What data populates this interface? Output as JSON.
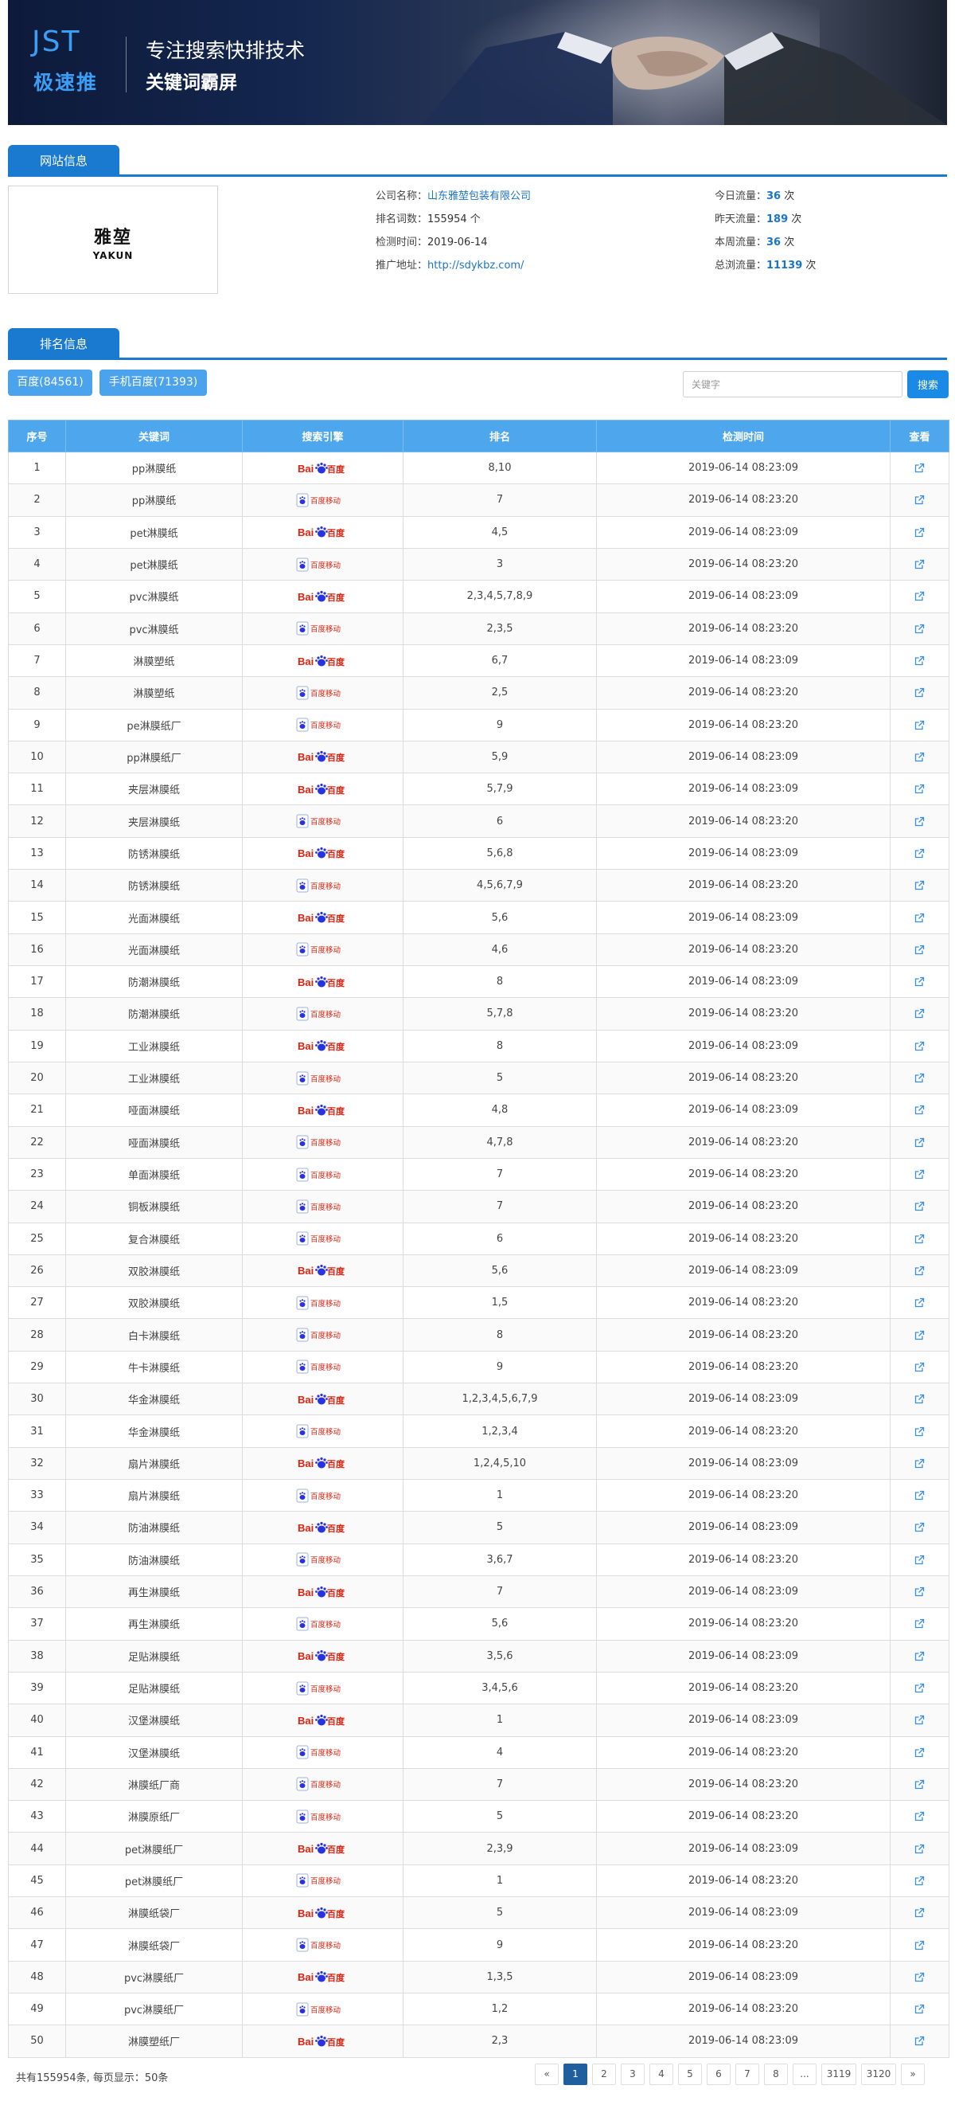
{
  "banner": {
    "logo_text": "JST",
    "logo_cn": "极速推",
    "slogan_line1": "专注搜索快排技术",
    "slogan_line2": "关键词霸屏"
  },
  "site_section": {
    "tab_label": "网站信息"
  },
  "site_logo": {
    "cn": "雅堃",
    "en": "YAKUN"
  },
  "site_info": {
    "company_label": "公司名称：",
    "company_value": "山东雅堃包装有限公司",
    "keywords_label": "排名词数：",
    "keywords_value": "155954 个",
    "check_label": "检测时间：",
    "check_value": "2019-06-14",
    "url_label": "推广地址：",
    "url_value": "http://sdykbz.com/"
  },
  "traffic": {
    "today_label": "今日流量：",
    "today_value": "36",
    "today_unit": "次",
    "yesterday_label": "昨天流量：",
    "yesterday_value": "189",
    "yesterday_unit": "次",
    "week_label": "本周流量：",
    "week_value": "36",
    "week_unit": "次",
    "total_label": "总浏流量：",
    "total_value": "11139",
    "total_unit": "次"
  },
  "rank_section": {
    "tab_label": "排名信息"
  },
  "engine_buttons": {
    "baidu": "百度(84561)",
    "mobile": "手机百度(71393)"
  },
  "search": {
    "placeholder": "关键字",
    "button_label": "搜索"
  },
  "table": {
    "headers": [
      "序号",
      "关键词",
      "搜索引擎",
      "排名",
      "检测时间",
      "查看"
    ],
    "rows": [
      {
        "no": "1",
        "kw": "pp淋膜纸",
        "engine": "baidu",
        "rank": "8,10",
        "time": "2019-06-14 08:23:09"
      },
      {
        "no": "2",
        "kw": "pp淋膜纸",
        "engine": "mobile",
        "rank": "7",
        "time": "2019-06-14 08:23:20"
      },
      {
        "no": "3",
        "kw": "pet淋膜纸",
        "engine": "baidu",
        "rank": "4,5",
        "time": "2019-06-14 08:23:09"
      },
      {
        "no": "4",
        "kw": "pet淋膜纸",
        "engine": "mobile",
        "rank": "3",
        "time": "2019-06-14 08:23:20"
      },
      {
        "no": "5",
        "kw": "pvc淋膜纸",
        "engine": "baidu",
        "rank": "2,3,4,5,7,8,9",
        "time": "2019-06-14 08:23:09"
      },
      {
        "no": "6",
        "kw": "pvc淋膜纸",
        "engine": "mobile",
        "rank": "2,3,5",
        "time": "2019-06-14 08:23:20"
      },
      {
        "no": "7",
        "kw": "淋膜塑纸",
        "engine": "baidu",
        "rank": "6,7",
        "time": "2019-06-14 08:23:09"
      },
      {
        "no": "8",
        "kw": "淋膜塑纸",
        "engine": "mobile",
        "rank": "2,5",
        "time": "2019-06-14 08:23:20"
      },
      {
        "no": "9",
        "kw": "pe淋膜纸厂",
        "engine": "mobile",
        "rank": "9",
        "time": "2019-06-14 08:23:20"
      },
      {
        "no": "10",
        "kw": "pp淋膜纸厂",
        "engine": "baidu",
        "rank": "5,9",
        "time": "2019-06-14 08:23:09"
      },
      {
        "no": "11",
        "kw": "夹层淋膜纸",
        "engine": "baidu",
        "rank": "5,7,9",
        "time": "2019-06-14 08:23:09"
      },
      {
        "no": "12",
        "kw": "夹层淋膜纸",
        "engine": "mobile",
        "rank": "6",
        "time": "2019-06-14 08:23:20"
      },
      {
        "no": "13",
        "kw": "防锈淋膜纸",
        "engine": "baidu",
        "rank": "5,6,8",
        "time": "2019-06-14 08:23:09"
      },
      {
        "no": "14",
        "kw": "防锈淋膜纸",
        "engine": "mobile",
        "rank": "4,5,6,7,9",
        "time": "2019-06-14 08:23:20"
      },
      {
        "no": "15",
        "kw": "光面淋膜纸",
        "engine": "baidu",
        "rank": "5,6",
        "time": "2019-06-14 08:23:09"
      },
      {
        "no": "16",
        "kw": "光面淋膜纸",
        "engine": "mobile",
        "rank": "4,6",
        "time": "2019-06-14 08:23:20"
      },
      {
        "no": "17",
        "kw": "防潮淋膜纸",
        "engine": "baidu",
        "rank": "8",
        "time": "2019-06-14 08:23:09"
      },
      {
        "no": "18",
        "kw": "防潮淋膜纸",
        "engine": "mobile",
        "rank": "5,7,8",
        "time": "2019-06-14 08:23:20"
      },
      {
        "no": "19",
        "kw": "工业淋膜纸",
        "engine": "baidu",
        "rank": "8",
        "time": "2019-06-14 08:23:09"
      },
      {
        "no": "20",
        "kw": "工业淋膜纸",
        "engine": "mobile",
        "rank": "5",
        "time": "2019-06-14 08:23:20"
      },
      {
        "no": "21",
        "kw": "哑面淋膜纸",
        "engine": "baidu",
        "rank": "4,8",
        "time": "2019-06-14 08:23:09"
      },
      {
        "no": "22",
        "kw": "哑面淋膜纸",
        "engine": "mobile",
        "rank": "4,7,8",
        "time": "2019-06-14 08:23:20"
      },
      {
        "no": "23",
        "kw": "单面淋膜纸",
        "engine": "mobile",
        "rank": "7",
        "time": "2019-06-14 08:23:20"
      },
      {
        "no": "24",
        "kw": "铜板淋膜纸",
        "engine": "mobile",
        "rank": "7",
        "time": "2019-06-14 08:23:20"
      },
      {
        "no": "25",
        "kw": "复合淋膜纸",
        "engine": "mobile",
        "rank": "6",
        "time": "2019-06-14 08:23:20"
      },
      {
        "no": "26",
        "kw": "双胶淋膜纸",
        "engine": "baidu",
        "rank": "5,6",
        "time": "2019-06-14 08:23:09"
      },
      {
        "no": "27",
        "kw": "双胶淋膜纸",
        "engine": "mobile",
        "rank": "1,5",
        "time": "2019-06-14 08:23:20"
      },
      {
        "no": "28",
        "kw": "白卡淋膜纸",
        "engine": "mobile",
        "rank": "8",
        "time": "2019-06-14 08:23:20"
      },
      {
        "no": "29",
        "kw": "牛卡淋膜纸",
        "engine": "mobile",
        "rank": "9",
        "time": "2019-06-14 08:23:20"
      },
      {
        "no": "30",
        "kw": "华金淋膜纸",
        "engine": "baidu",
        "rank": "1,2,3,4,5,6,7,9",
        "time": "2019-06-14 08:23:09"
      },
      {
        "no": "31",
        "kw": "华金淋膜纸",
        "engine": "mobile",
        "rank": "1,2,3,4",
        "time": "2019-06-14 08:23:20"
      },
      {
        "no": "32",
        "kw": "扇片淋膜纸",
        "engine": "baidu",
        "rank": "1,2,4,5,10",
        "time": "2019-06-14 08:23:09"
      },
      {
        "no": "33",
        "kw": "扇片淋膜纸",
        "engine": "mobile",
        "rank": "1",
        "time": "2019-06-14 08:23:20"
      },
      {
        "no": "34",
        "kw": "防油淋膜纸",
        "engine": "baidu",
        "rank": "5",
        "time": "2019-06-14 08:23:09"
      },
      {
        "no": "35",
        "kw": "防油淋膜纸",
        "engine": "mobile",
        "rank": "3,6,7",
        "time": "2019-06-14 08:23:20"
      },
      {
        "no": "36",
        "kw": "再生淋膜纸",
        "engine": "baidu",
        "rank": "7",
        "time": "2019-06-14 08:23:09"
      },
      {
        "no": "37",
        "kw": "再生淋膜纸",
        "engine": "mobile",
        "rank": "5,6",
        "time": "2019-06-14 08:23:20"
      },
      {
        "no": "38",
        "kw": "足贴淋膜纸",
        "engine": "baidu",
        "rank": "3,5,6",
        "time": "2019-06-14 08:23:09"
      },
      {
        "no": "39",
        "kw": "足贴淋膜纸",
        "engine": "mobile",
        "rank": "3,4,5,6",
        "time": "2019-06-14 08:23:20"
      },
      {
        "no": "40",
        "kw": "汉堡淋膜纸",
        "engine": "baidu",
        "rank": "1",
        "time": "2019-06-14 08:23:09"
      },
      {
        "no": "41",
        "kw": "汉堡淋膜纸",
        "engine": "mobile",
        "rank": "4",
        "time": "2019-06-14 08:23:20"
      },
      {
        "no": "42",
        "kw": "淋膜纸厂商",
        "engine": "mobile",
        "rank": "7",
        "time": "2019-06-14 08:23:20"
      },
      {
        "no": "43",
        "kw": "淋膜原纸厂",
        "engine": "mobile",
        "rank": "5",
        "time": "2019-06-14 08:23:20"
      },
      {
        "no": "44",
        "kw": "pet淋膜纸厂",
        "engine": "baidu",
        "rank": "2,3,9",
        "time": "2019-06-14 08:23:09"
      },
      {
        "no": "45",
        "kw": "pet淋膜纸厂",
        "engine": "mobile",
        "rank": "1",
        "time": "2019-06-14 08:23:20"
      },
      {
        "no": "46",
        "kw": "淋膜纸袋厂",
        "engine": "baidu",
        "rank": "5",
        "time": "2019-06-14 08:23:09"
      },
      {
        "no": "47",
        "kw": "淋膜纸袋厂",
        "engine": "mobile",
        "rank": "9",
        "time": "2019-06-14 08:23:20"
      },
      {
        "no": "48",
        "kw": "pvc淋膜纸厂",
        "engine": "baidu",
        "rank": "1,3,5",
        "time": "2019-06-14 08:23:09"
      },
      {
        "no": "49",
        "kw": "pvc淋膜纸厂",
        "engine": "mobile",
        "rank": "1,2",
        "time": "2019-06-14 08:23:20"
      },
      {
        "no": "50",
        "kw": "淋膜塑纸厂",
        "engine": "baidu",
        "rank": "2,3",
        "time": "2019-06-14 08:23:09"
      }
    ]
  },
  "engine_labels": {
    "baidu_text": "Bai",
    "baidu_cn": "百度",
    "mobile_cn": "百度移动"
  },
  "pagination": {
    "summary": "共有155954条, 每页显示：50条",
    "items": [
      "«",
      "1",
      "2",
      "3",
      "4",
      "5",
      "6",
      "7",
      "8",
      "...",
      "3119",
      "3120",
      "»"
    ],
    "active": "1"
  },
  "colors": {
    "primary": "#1a7ad0",
    "header_blue": "#4ea6ec",
    "baidu_red": "#de2210",
    "baidu_blue": "#2932e1"
  }
}
